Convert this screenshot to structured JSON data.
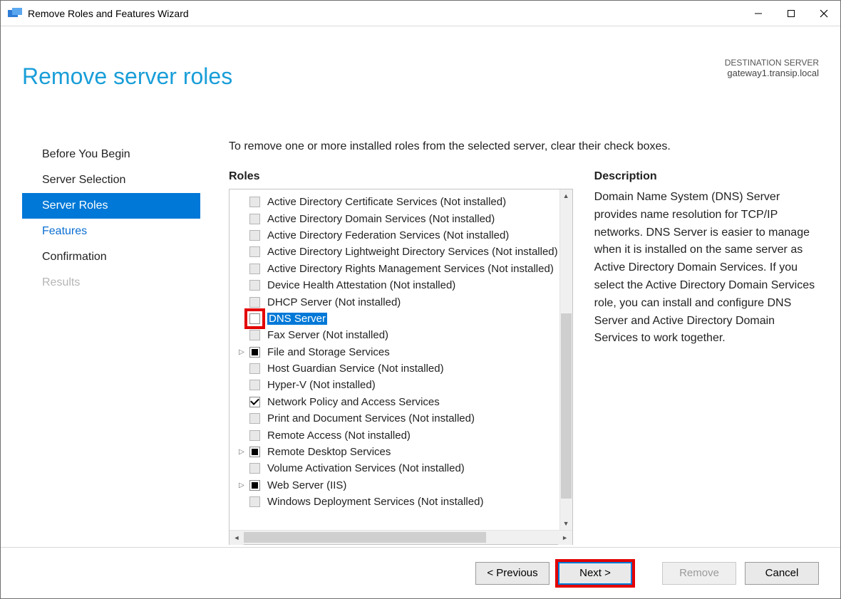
{
  "window_title": "Remove Roles and Features Wizard",
  "page_title": "Remove server roles",
  "destination": {
    "label": "DESTINATION SERVER",
    "server": "gateway1.transip.local"
  },
  "steps": [
    {
      "label": "Before You Begin",
      "state": "normal"
    },
    {
      "label": "Server Selection",
      "state": "normal"
    },
    {
      "label": "Server Roles",
      "state": "active"
    },
    {
      "label": "Features",
      "state": "link"
    },
    {
      "label": "Confirmation",
      "state": "normal"
    },
    {
      "label": "Results",
      "state": "disabled"
    }
  ],
  "instruction": "To remove one or more installed roles from the selected server, clear their check boxes.",
  "roles_heading": "Roles",
  "roles": [
    {
      "label": "Active Directory Certificate Services (Not installed)",
      "state": "disabled"
    },
    {
      "label": "Active Directory Domain Services (Not installed)",
      "state": "disabled"
    },
    {
      "label": "Active Directory Federation Services (Not installed)",
      "state": "disabled"
    },
    {
      "label": "Active Directory Lightweight Directory Services (Not installed)",
      "state": "disabled"
    },
    {
      "label": "Active Directory Rights Management Services (Not installed)",
      "state": "disabled"
    },
    {
      "label": "Device Health Attestation (Not installed)",
      "state": "disabled"
    },
    {
      "label": "DHCP Server (Not installed)",
      "state": "disabled"
    },
    {
      "label": "DNS Server",
      "state": "unchecked",
      "selected": true,
      "highlight": true
    },
    {
      "label": "Fax Server (Not installed)",
      "state": "disabled"
    },
    {
      "label": "File and Storage Services",
      "state": "partial",
      "expandable": true
    },
    {
      "label": "Host Guardian Service (Not installed)",
      "state": "disabled"
    },
    {
      "label": "Hyper-V (Not installed)",
      "state": "disabled"
    },
    {
      "label": "Network Policy and Access Services",
      "state": "checked"
    },
    {
      "label": "Print and Document Services (Not installed)",
      "state": "disabled"
    },
    {
      "label": "Remote Access (Not installed)",
      "state": "disabled"
    },
    {
      "label": "Remote Desktop Services",
      "state": "partial",
      "expandable": true
    },
    {
      "label": "Volume Activation Services (Not installed)",
      "state": "disabled"
    },
    {
      "label": "Web Server (IIS)",
      "state": "partial",
      "expandable": true
    },
    {
      "label": "Windows Deployment Services (Not installed)",
      "state": "disabled"
    }
  ],
  "description_heading": "Description",
  "description": "Domain Name System (DNS) Server provides name resolution for TCP/IP networks. DNS Server is easier to manage when it is installed on the same server as Active Directory Domain Services. If you select the Active Directory Domain Services role, you can install and configure DNS Server and Active Directory Domain Services to work together.",
  "buttons": {
    "previous": "< Previous",
    "next": "Next >",
    "remove": "Remove",
    "cancel": "Cancel"
  }
}
